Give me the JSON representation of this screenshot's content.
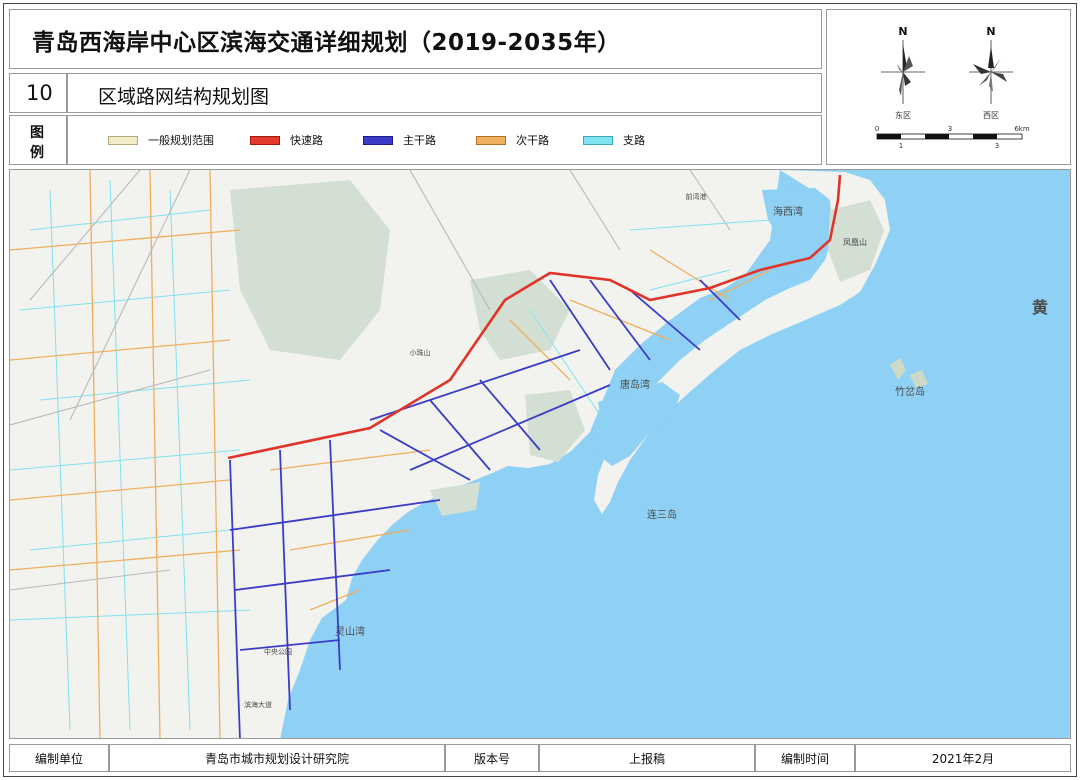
{
  "header": {
    "title": "青岛西海岸中心区滨海交通详细规划（2019-2035年）",
    "plan_number": "10",
    "plan_name": "区域路网结构规划图",
    "legend_label_1": "图",
    "legend_label_2": "例"
  },
  "legend": [
    {
      "label": "一般规划范围",
      "color": "#f3ecc8",
      "border": "#b8a878"
    },
    {
      "label": "快速路",
      "color": "#e33a2c",
      "border": "#9a1a10"
    },
    {
      "label": "主干路",
      "color": "#3a3cc8",
      "border": "#1a1a80"
    },
    {
      "label": "次干路",
      "color": "#f0b060",
      "border": "#b07020"
    },
    {
      "label": "支路",
      "color": "#7fe3f0",
      "border": "#3aa8b8"
    }
  ],
  "compass": {
    "north_1": "N",
    "north_2": "N",
    "district_1": "东区",
    "district_2": "西区",
    "scale_km": "6km",
    "scale_ticks_top": [
      "0",
      "3",
      "6km"
    ],
    "scale_ticks_bottom": [
      "1",
      "3"
    ]
  },
  "map": {
    "sea_label": "黄",
    "places": [
      "海西湾",
      "凤凰山",
      "唐岛湾",
      "竹岔岛",
      "连三岛",
      "灵山湾",
      "滨海大道",
      "中央公园",
      "小珠山",
      "前湾港"
    ],
    "colors": {
      "sea": "#8fd0f5",
      "land": "#f2f3ef",
      "hill": "#d3dfd3",
      "expressway": "#e0342a",
      "arterial": "#3b3dc8",
      "secondary": "#f0ae5c",
      "branch": "#7fe1ef"
    }
  },
  "footer": {
    "org_label": "编制单位",
    "org_value": "青岛市城市规划设计研究院",
    "version_label": "版本号",
    "version_value": "上报稿",
    "time_label": "编制时间",
    "time_value": "2021年2月"
  }
}
